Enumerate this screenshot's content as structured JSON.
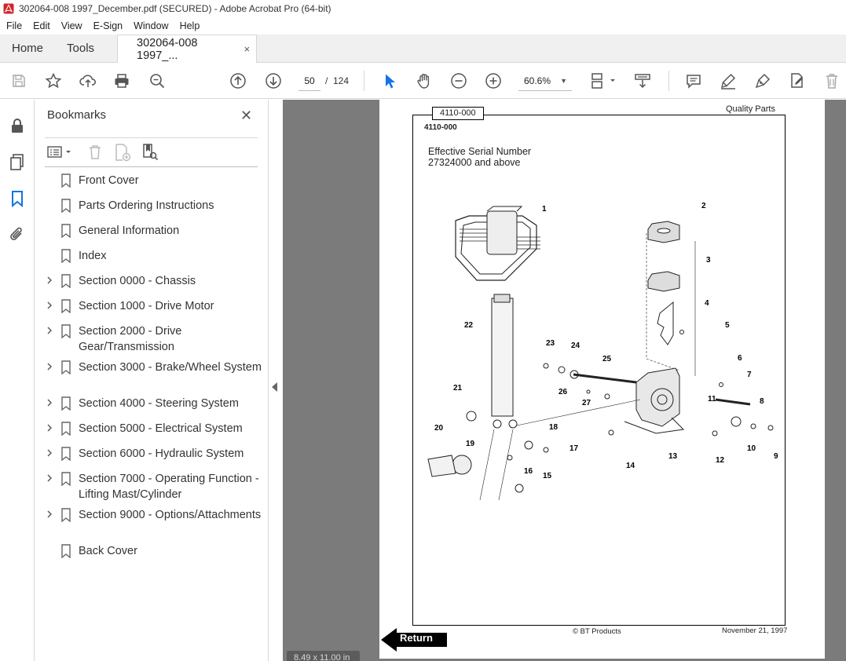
{
  "window": {
    "title": "302064-008 1997_December.pdf (SECURED) - Adobe Acrobat Pro (64-bit)",
    "app_icon": "acrobat-icon"
  },
  "menu": [
    "File",
    "Edit",
    "View",
    "E-Sign",
    "Window",
    "Help"
  ],
  "tabs": {
    "home": "Home",
    "tools": "Tools",
    "document": "302064-008 1997_...",
    "close": "×"
  },
  "toolbar": {
    "icons": [
      "save-icon",
      "bookmark-star-icon",
      "upload-icon",
      "print-icon",
      "zoom-search-icon",
      "page-up-icon",
      "page-down-icon",
      "select-arrow-icon",
      "hand-icon",
      "zoom-out-icon",
      "zoom-in-icon",
      "page-fit-icon",
      "scroll-mode-icon",
      "comment-icon",
      "highlight-icon",
      "sign-icon",
      "edit-pdf-icon",
      "delete-icon"
    ],
    "current_page": "50",
    "page_sep": "/",
    "page_total": "124",
    "zoom": "60.6%"
  },
  "rail_icons": [
    "lock-icon",
    "pages-icon",
    "bookmarks-icon",
    "attachments-icon"
  ],
  "bookmarks": {
    "title": "Bookmarks",
    "close": "✕",
    "items": [
      {
        "label": "Front Cover",
        "expandable": false
      },
      {
        "label": "Parts Ordering Instructions",
        "expandable": false
      },
      {
        "label": "General Information",
        "expandable": false
      },
      {
        "label": "Index",
        "expandable": false
      },
      {
        "label": "Section 0000 - Chassis",
        "expandable": true
      },
      {
        "label": "Section 1000 - Drive Motor",
        "expandable": true
      },
      {
        "label": "Section 2000 - Drive Gear/Transmission",
        "expandable": true
      },
      {
        "label": "Section 3000 - Brake/Wheel System",
        "expandable": true
      },
      {
        "label": "Section 4000 - Steering System",
        "expandable": true
      },
      {
        "label": "Section 5000 - Electrical System",
        "expandable": true
      },
      {
        "label": "Section 6000 - Hydraulic System",
        "expandable": true
      },
      {
        "label": "Section 7000 - Operating Function - Lifting Mast/Cylinder",
        "expandable": true
      },
      {
        "label": "Section 9000 - Options/Attachments",
        "expandable": true
      },
      {
        "label": "Back Cover",
        "expandable": false
      }
    ]
  },
  "page": {
    "tag": "4110-000",
    "code": "4110-000",
    "quality": "Quality Parts",
    "effective_1": "Effective Serial Number",
    "effective_2": "27324000 and above",
    "copyright": "© BT Products",
    "date": "November 21, 1997",
    "return": "Return",
    "part_numbers": [
      "1",
      "2",
      "3",
      "4",
      "5",
      "6",
      "7",
      "8",
      "9",
      "10",
      "11",
      "12",
      "13",
      "14",
      "15",
      "16",
      "17",
      "18",
      "19",
      "20",
      "21",
      "22",
      "23",
      "24",
      "25",
      "26",
      "27"
    ]
  },
  "page_size": "8.49 x 11.00 in"
}
